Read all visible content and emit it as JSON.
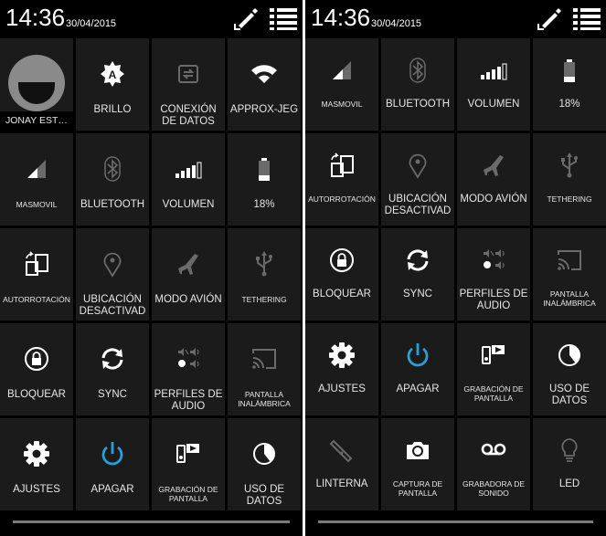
{
  "colors": {
    "accent": "#2a9fd6",
    "tile_bg": "#1b1b1b",
    "text": "#e6e6e6"
  },
  "left": {
    "time": "14:36",
    "date": "30/04/2015",
    "tiles": [
      {
        "label": "JONAY EST…",
        "icon": "avatar"
      },
      {
        "label": "BRILLO",
        "icon": "brightness-icon"
      },
      {
        "label": "CONEXIÓN DE DATOS",
        "icon": "data-connection-icon"
      },
      {
        "label": "APPROX-JEG",
        "icon": "wifi-icon"
      },
      {
        "label": "MASMOVIL",
        "icon": "signal-icon"
      },
      {
        "label": "BLUETOOTH",
        "icon": "bluetooth-icon"
      },
      {
        "label": "VOLUMEN",
        "icon": "volume-icon"
      },
      {
        "label": "18%",
        "icon": "battery-icon"
      },
      {
        "label": "AUTORROTACIÓN",
        "icon": "autorotate-icon"
      },
      {
        "label": "UBICACIÓN DESACTIVAD",
        "icon": "location-icon"
      },
      {
        "label": "MODO AVIÓN",
        "icon": "airplane-icon"
      },
      {
        "label": "TETHERING",
        "icon": "usb-icon"
      },
      {
        "label": "BLOQUEAR",
        "icon": "lock-icon"
      },
      {
        "label": "SYNC",
        "icon": "sync-icon"
      },
      {
        "label": "PERFILES DE AUDIO",
        "icon": "audio-profiles-icon"
      },
      {
        "label": "PANTALLA INALÁMBRICA",
        "icon": "cast-icon"
      },
      {
        "label": "AJUSTES",
        "icon": "gear-icon"
      },
      {
        "label": "APAGAR",
        "icon": "power-icon"
      },
      {
        "label": "GRABACIÓN DE PANTALLA",
        "icon": "screen-record-icon"
      },
      {
        "label": "USO DE DATOS",
        "icon": "data-usage-icon"
      }
    ]
  },
  "right": {
    "time": "14:36",
    "date": "30/04/2015",
    "tiles": [
      {
        "label": "MASMOVIL",
        "icon": "signal-icon"
      },
      {
        "label": "BLUETOOTH",
        "icon": "bluetooth-icon"
      },
      {
        "label": "VOLUMEN",
        "icon": "volume-icon"
      },
      {
        "label": "18%",
        "icon": "battery-icon"
      },
      {
        "label": "AUTORROTACIÓN",
        "icon": "autorotate-icon"
      },
      {
        "label": "UBICACIÓN DESACTIVAD",
        "icon": "location-icon"
      },
      {
        "label": "MODO AVIÓN",
        "icon": "airplane-icon"
      },
      {
        "label": "TETHERING",
        "icon": "usb-icon"
      },
      {
        "label": "BLOQUEAR",
        "icon": "lock-icon"
      },
      {
        "label": "SYNC",
        "icon": "sync-icon"
      },
      {
        "label": "PERFILES DE AUDIO",
        "icon": "audio-profiles-icon"
      },
      {
        "label": "PANTALLA INALÁMBRICA",
        "icon": "cast-icon"
      },
      {
        "label": "AJUSTES",
        "icon": "gear-icon"
      },
      {
        "label": "APAGAR",
        "icon": "power-icon"
      },
      {
        "label": "GRABACIÓN DE PANTALLA",
        "icon": "screen-record-icon"
      },
      {
        "label": "USO DE DATOS",
        "icon": "data-usage-icon"
      },
      {
        "label": "LINTERNA",
        "icon": "flashlight-icon"
      },
      {
        "label": "CAPTURA DE PANTALLA",
        "icon": "screenshot-icon"
      },
      {
        "label": "GRABADORA DE SONIDO",
        "icon": "sound-recorder-icon"
      },
      {
        "label": "LED",
        "icon": "led-icon"
      }
    ]
  }
}
